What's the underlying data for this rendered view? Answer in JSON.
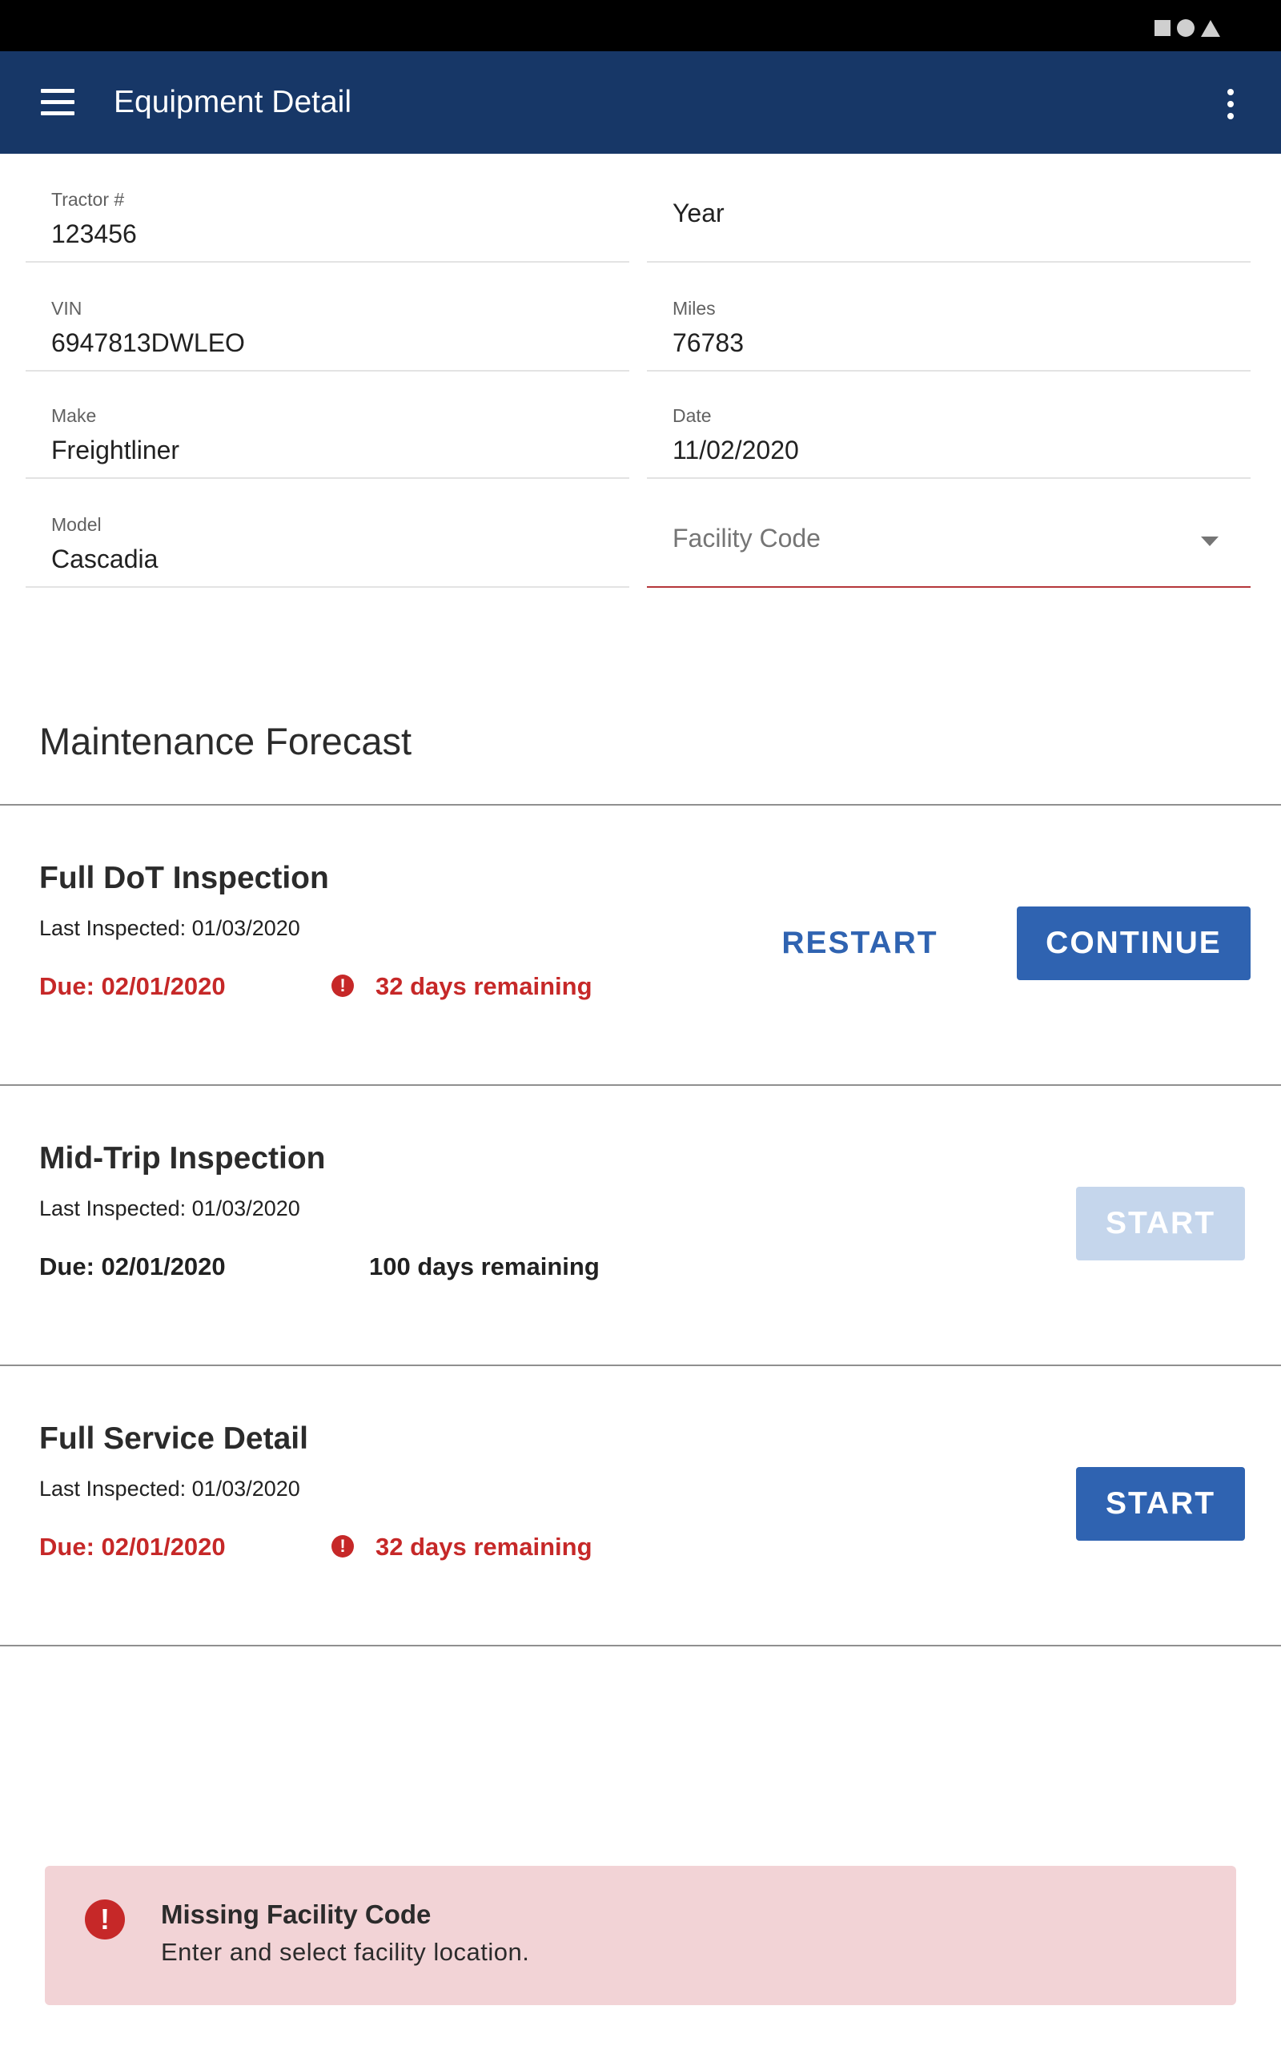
{
  "app_bar": {
    "title": "Equipment Detail",
    "menu_icon": "hamburger-menu-icon",
    "overflow_icon": "more-vert-icon",
    "background": "#173767"
  },
  "fields": {
    "tractor": {
      "label": "Tractor #",
      "value": "123456"
    },
    "year": {
      "placeholder": "Year"
    },
    "vin": {
      "label": "VIN",
      "value": "6947813DWLEO"
    },
    "miles": {
      "label": "Miles",
      "value": "76783"
    },
    "make": {
      "label": "Make",
      "value": "Freightliner"
    },
    "date": {
      "label": "Date",
      "value": "11/02/2020"
    },
    "model": {
      "label": "Model",
      "value": "Cascadia"
    },
    "facility_code": {
      "placeholder": "Facility Code"
    }
  },
  "maintenance": {
    "title": "Maintenance Forecast",
    "items": [
      {
        "title": "Full DoT Inspection",
        "last_inspected": "Last Inspected: 01/03/2020",
        "due": "Due: 02/01/2020",
        "days": "32 days remaining",
        "status": "warning",
        "secondary_label": "RESTART",
        "primary_label": "CONTINUE"
      },
      {
        "title": "Mid-Trip Inspection",
        "last_inspected": "Last Inspected: 01/03/2020",
        "due": "Due: 02/01/2020",
        "days": "100 days remaining",
        "status": "ok",
        "primary_label": "START",
        "primary_disabled": true
      },
      {
        "title": "Full Service Detail",
        "last_inspected": "Last Inspected: 01/03/2020",
        "due": "Due: 02/01/2020",
        "days": "32 days remaining",
        "status": "warning",
        "primary_label": "START"
      }
    ]
  },
  "snackbar": {
    "icon": "error-icon",
    "title": "Missing Facility Code",
    "message": "Enter and select facility location."
  },
  "colors": {
    "accent": "#2f63b1",
    "error": "#c62828",
    "snackbar_bg": "#f2d3d6"
  }
}
